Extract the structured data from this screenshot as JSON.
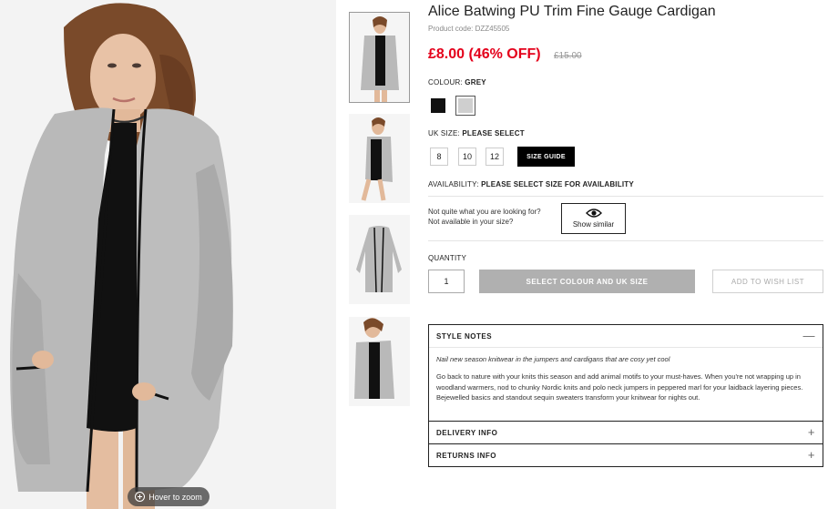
{
  "product": {
    "title": "Alice Batwing PU Trim Fine Gauge Cardigan",
    "product_code": "Product code: DZZ45505",
    "price_now": "£8.00 (46% OFF)",
    "price_was": "£15.00"
  },
  "image": {
    "zoom_label": "Hover to zoom"
  },
  "colour": {
    "label": "COLOUR:",
    "value": "GREY",
    "swatches": [
      {
        "name": "Black",
        "color": "#111111"
      },
      {
        "name": "Grey",
        "color": "#cfcfcf"
      }
    ]
  },
  "size": {
    "label": "UK SIZE:",
    "value": "PLEASE SELECT",
    "options": [
      "8",
      "10",
      "12"
    ],
    "guide_label": "SIZE GUIDE"
  },
  "availability": {
    "label": "AVAILABILITY:",
    "value": "PLEASE SELECT SIZE FOR AVAILABILITY"
  },
  "similar": {
    "line1": "Not quite what you are looking for?",
    "line2": "Not available in your size?",
    "button_label": "Show similar"
  },
  "purchase": {
    "quantity_label": "QUANTITY",
    "quantity_value": "1",
    "select_button": "SELECT COLOUR AND UK SIZE",
    "wishlist_button": "ADD TO WISH LIST"
  },
  "accordion": {
    "style_notes_title": "STYLE NOTES",
    "style_notes_toggle": "—",
    "style_notes_em": "Nail new season knitwear in the jumpers and cardigans that are cosy yet cool",
    "style_notes_body": "Go back to nature with your knits this season and add animal motifs to your must-haves. When you're not wrapping up in woodland warmers, nod to chunky Nordic knits and polo neck jumpers in peppered marl for your laidback layering pieces. Bejewelled basics and standout sequin sweaters transform your knitwear for nights out.",
    "delivery_title": "DELIVERY INFO",
    "returns_title": "RETURNS INFO",
    "collapsed_toggle": "+"
  },
  "colors": {
    "sale_red": "#e4001b",
    "cardigan_grey": "#b8b8b8",
    "button_grey": "#b0b0b0"
  }
}
